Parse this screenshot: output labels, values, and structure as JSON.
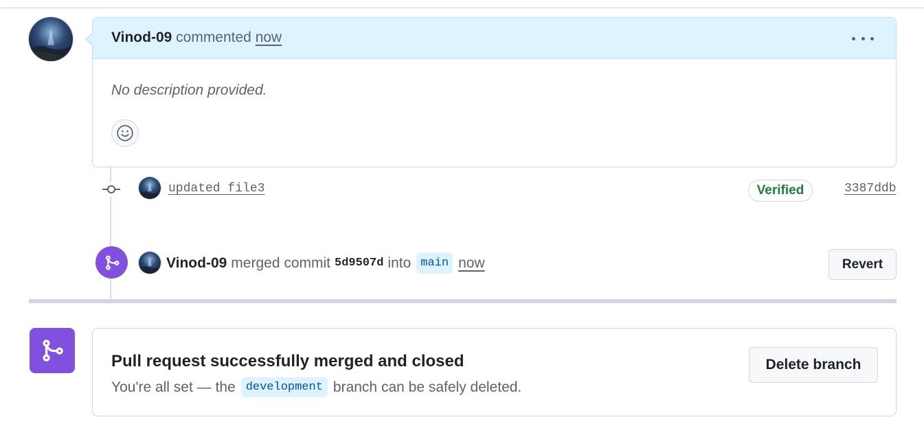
{
  "colors": {
    "accent_blue_bg": "#ddf4ff",
    "accent_blue_border": "#b6e3ff",
    "merged_purple": "#8250df",
    "verified_green": "#1a7f37",
    "muted_text": "#59636e",
    "border": "#d0d7de"
  },
  "comment": {
    "author": "Vinod-09",
    "action": "commented",
    "timestamp": "now",
    "body": "No description provided.",
    "menu_icon": "kebab-horizontal-icon",
    "reaction_icon": "smiley-icon"
  },
  "commit": {
    "message": "updated file3",
    "badge": "Verified",
    "sha": "3387ddb",
    "icon": "git-commit-icon"
  },
  "merge_event": {
    "author": "Vinod-09",
    "action": "merged commit",
    "sha": "5d9507d",
    "into": "into",
    "branch": "main",
    "timestamp": "now",
    "revert_label": "Revert",
    "icon": "git-merge-icon"
  },
  "merge_status": {
    "title": "Pull request successfully merged and closed",
    "sub_prefix": "You're all set — the",
    "branch": "development",
    "sub_suffix": "branch can be safely deleted.",
    "delete_label": "Delete branch",
    "icon": "git-merge-icon"
  }
}
